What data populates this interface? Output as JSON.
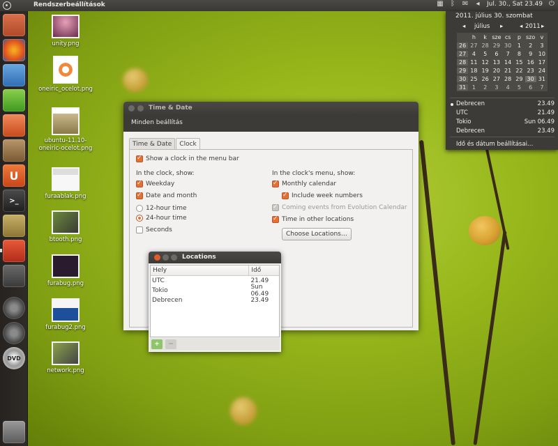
{
  "top_panel": {
    "app_title": "Rendszerbeállítások",
    "clock": "Jul. 30., Sat 23.49"
  },
  "desktop_icons": [
    {
      "name": "unity.png"
    },
    {
      "name": "oneiric_ocelot.png"
    },
    {
      "name": "ubuntu-11.10-\noneiric-ocelot.png"
    },
    {
      "name": "furaablak.png"
    },
    {
      "name": "btooth.png"
    },
    {
      "name": "furabug.png"
    },
    {
      "name": "furabug2.png"
    },
    {
      "name": "network.png"
    }
  ],
  "launcher": [
    {
      "icon": "home-folder-icon"
    },
    {
      "icon": "firefox-icon"
    },
    {
      "icon": "writer-icon"
    },
    {
      "icon": "calc-icon"
    },
    {
      "icon": "impress-icon"
    },
    {
      "icon": "software-center-icon"
    },
    {
      "icon": "ubuntu-one-icon",
      "glyph": "U"
    },
    {
      "icon": "terminal-icon",
      "glyph": ">_"
    },
    {
      "icon": "archive-icon"
    },
    {
      "icon": "system-settings-icon"
    },
    {
      "icon": "workspace-switcher-icon"
    },
    {
      "icon": "applications-lens-icon"
    },
    {
      "icon": "files-lens-icon"
    },
    {
      "icon": "dvd-icon",
      "glyph": "DVD"
    },
    {
      "icon": "trash-icon"
    }
  ],
  "window": {
    "title": "Time & Date",
    "menu": "Minden beállítás",
    "tabs": [
      "Time & Date",
      "Clock"
    ],
    "active_tab": "Clock",
    "show_clock": "Show a clock in the menu bar",
    "in_clock_header": "In the clock, show:",
    "weekday": "Weekday",
    "date_month": "Date and month",
    "h12": "12-hour time",
    "h24": "24-hour time",
    "seconds": "Seconds",
    "in_menu_header": "In the clock's menu, show:",
    "monthly_calendar": "Monthly calendar",
    "week_numbers": "Include week numbers",
    "evolution": "Coming events from Evolution Calendar",
    "other_locations": "Time in other locations",
    "choose_locations": "Choose Locations…"
  },
  "locations_dialog": {
    "title": "Locations",
    "col_place": "Hely",
    "col_time": "Idő",
    "rows": [
      {
        "place": "UTC",
        "time": "21.49"
      },
      {
        "place": "Tokio",
        "time": "Sun 06.49"
      },
      {
        "place": "Debrecen",
        "time": "23.49"
      }
    ],
    "add": "+",
    "remove": "−"
  },
  "calendar_menu": {
    "full_date": "2011. július 30. szombat",
    "month": "július",
    "year": "2011",
    "weekday_heads": [
      "h",
      "k",
      "sze",
      "cs",
      "p",
      "szo",
      "v"
    ],
    "weeks": [
      {
        "wk": "26",
        "days": [
          "27",
          "28",
          "29",
          "30",
          "1",
          "2",
          "3"
        ]
      },
      {
        "wk": "27",
        "days": [
          "4",
          "5",
          "6",
          "7",
          "8",
          "9",
          "10"
        ]
      },
      {
        "wk": "28",
        "days": [
          "11",
          "12",
          "13",
          "14",
          "15",
          "16",
          "17"
        ]
      },
      {
        "wk": "29",
        "days": [
          "18",
          "19",
          "20",
          "21",
          "22",
          "23",
          "24"
        ]
      },
      {
        "wk": "30",
        "days": [
          "25",
          "26",
          "27",
          "28",
          "29",
          "30",
          "31"
        ]
      },
      {
        "wk": "31",
        "days": [
          "1",
          "2",
          "3",
          "4",
          "5",
          "6",
          "7"
        ]
      }
    ],
    "locations": [
      {
        "place": "Debrecen",
        "time": "23.49"
      },
      {
        "place": "UTC",
        "time": "21.49"
      },
      {
        "place": "Tokio",
        "time": "Sun 06.49"
      },
      {
        "place": "Debrecen",
        "time": "23.49"
      }
    ],
    "settings_item": "Idő és dátum beállításai…"
  },
  "colors": {
    "accent": "#e76f32",
    "panel": "#3c3b37"
  }
}
